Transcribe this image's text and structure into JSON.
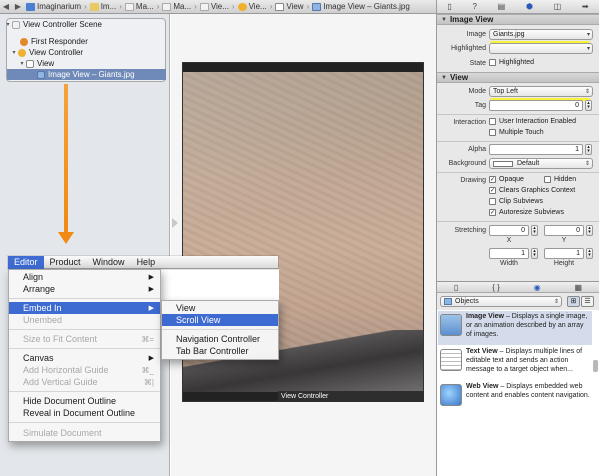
{
  "jump_bar": {
    "back": "◀",
    "forward": "▶",
    "crumbs": [
      "Imaginarium",
      "Im...",
      "Ma...",
      "Ma...",
      "Vie...",
      "Vie...",
      "View",
      "Image View – Giants.jpg"
    ]
  },
  "outline": {
    "scene_title": "View Controller Scene",
    "items": [
      "First Responder",
      "View Controller",
      "View",
      "Image View – Giants.jpg"
    ]
  },
  "canvas": {
    "vc_bar_label": "View Controller"
  },
  "inspector": {
    "image_view_header": "Image View",
    "image_label": "Image",
    "image_value": "Giants.jpg",
    "highlighted_label": "Highlighted",
    "highlighted_value": "",
    "state_label": "State",
    "state_highlighted": "Highlighted",
    "view_header": "View",
    "mode_label": "Mode",
    "mode_value": "Top Left",
    "tag_label": "Tag",
    "tag_value": "0",
    "interaction_label": "Interaction",
    "user_interaction": "User Interaction Enabled",
    "multiple_touch": "Multiple Touch",
    "alpha_label": "Alpha",
    "alpha_value": "1",
    "background_label": "Background",
    "background_value": "Default",
    "drawing_label": "Drawing",
    "opaque": "Opaque",
    "hidden": "Hidden",
    "clears_graphics": "Clears Graphics Context",
    "clip_subviews": "Clip Subviews",
    "autoresize_subviews": "Autoresize Subviews",
    "stretching_label": "Stretching",
    "stretch_x": "0",
    "stretch_y": "0",
    "stretch_width": "1",
    "stretch_height": "1",
    "x_label": "X",
    "y_label": "Y",
    "width_label": "Width",
    "height_label": "Height",
    "accent_color": "#f7f33a"
  },
  "library": {
    "filter_value": "Objects",
    "items": [
      {
        "title": "Image View",
        "desc": " – Displays a single image, or an animation described by an array of images."
      },
      {
        "title": "Text View",
        "desc": " – Displays multiple lines of editable text and sends an action message to a target object when..."
      },
      {
        "title": "Web View",
        "desc": " – Displays embedded web content and enables content navigation."
      }
    ]
  },
  "menu": {
    "bar": [
      "Editor",
      "Product",
      "Window",
      "Help"
    ],
    "editor_items": {
      "align": "Align",
      "arrange": "Arrange",
      "embed_in": "Embed In",
      "unembed": "Unembed",
      "size_to_fit": "Size to Fit Content",
      "size_to_fit_key": "⌘=",
      "canvas": "Canvas",
      "add_horizontal_guide": "Add Horizontal Guide",
      "add_horizontal_key": "⌘_",
      "add_vertical_guide": "Add Vertical Guide",
      "add_vertical_key": "⌘|",
      "hide_outline": "Hide Document Outline",
      "reveal_outline": "Reveal in Document Outline",
      "simulate": "Simulate Document"
    },
    "embed_submenu": [
      "View",
      "Scroll View",
      "Navigation Controller",
      "Tab Bar Controller"
    ]
  }
}
